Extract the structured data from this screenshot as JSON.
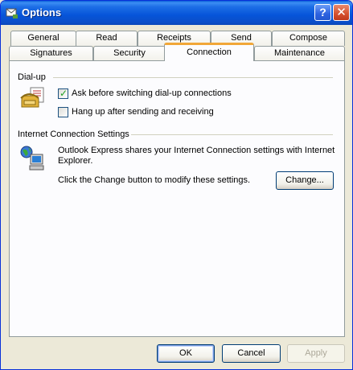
{
  "window": {
    "title": "Options"
  },
  "titlebar": {
    "help_label": "?",
    "close_label": "✕"
  },
  "tabs_row1": [
    "General",
    "Read",
    "Receipts",
    "Send",
    "Compose"
  ],
  "tabs_row2": [
    "Signatures",
    "Security",
    "Connection",
    "Maintenance"
  ],
  "active_tab": "Connection",
  "dialup": {
    "label": "Dial-up",
    "ask_label": "Ask before switching dial-up connections",
    "ask_checked": true,
    "hangup_label": "Hang up after sending and receiving",
    "hangup_checked": false
  },
  "internet": {
    "label": "Internet Connection Settings",
    "line1": "Outlook Express shares your Internet Connection settings with Internet",
    "line2": "Explorer.",
    "change_hint": "Click the Change button to modify these settings.",
    "change_label": "Change..."
  },
  "footer": {
    "ok_label": "OK",
    "cancel_label": "Cancel",
    "apply_label": "Apply"
  }
}
